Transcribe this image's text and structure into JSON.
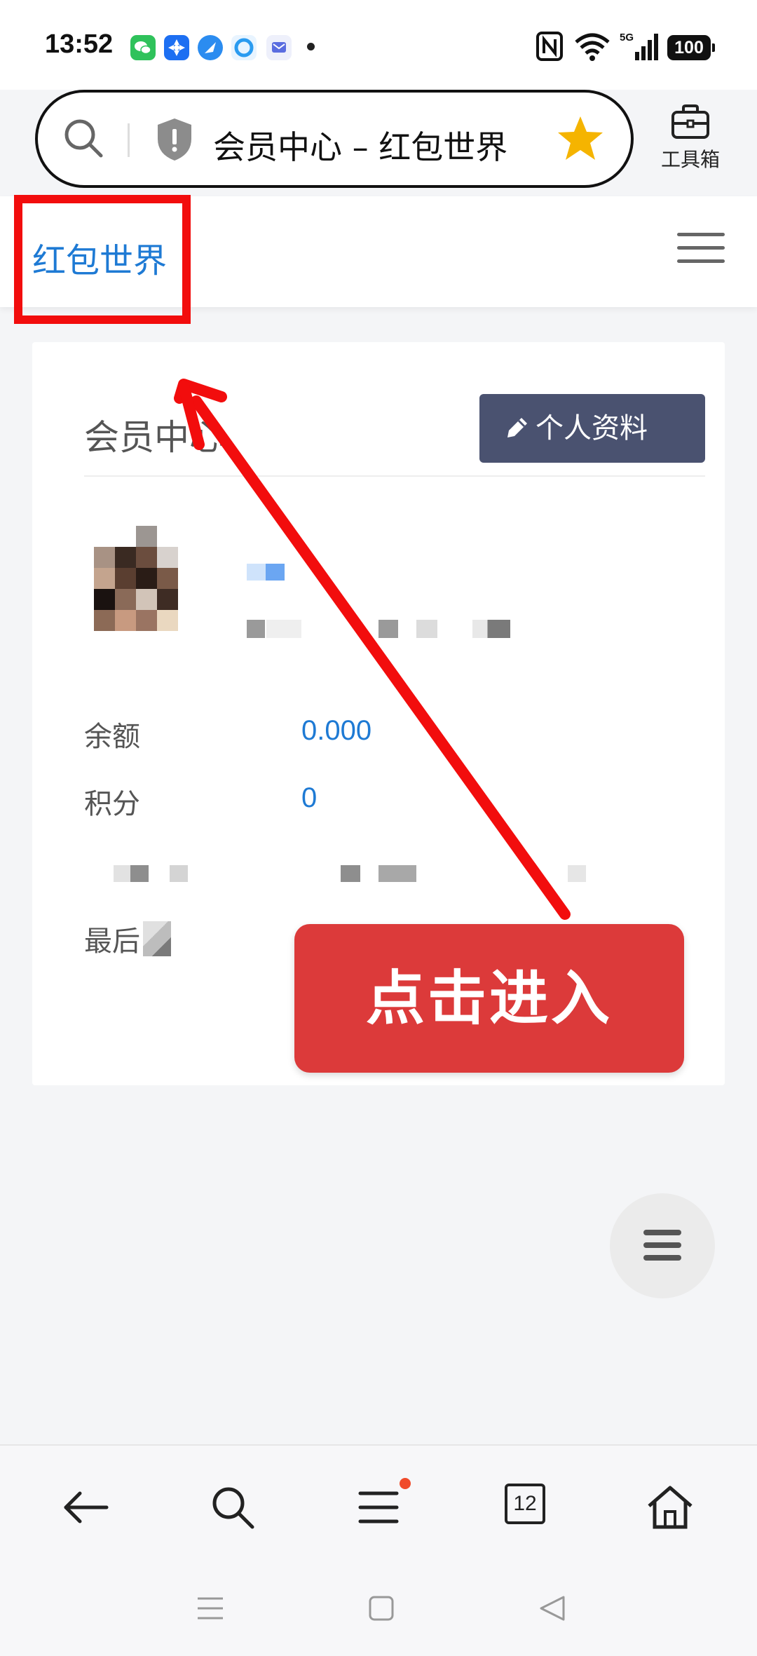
{
  "status_bar": {
    "time": "13:52",
    "battery": "100",
    "network": "5G",
    "apps": [
      "wechat-icon",
      "pinwheel-icon",
      "browser-icon",
      "qq-browser-icon",
      "message-icon"
    ],
    "indicators": [
      "nfc-icon",
      "wifi-icon",
      "signal-icon"
    ]
  },
  "address_bar": {
    "page_title": "会员中心 – 红包世界",
    "icons": [
      "search-icon",
      "shield-icon",
      "star-icon"
    ],
    "star_color": "#f5b400"
  },
  "toolbox": {
    "label": "工具箱",
    "icon": "toolbox-icon"
  },
  "site_header": {
    "brand": "红包世界",
    "brand_color": "#1e7ad4",
    "menu_icon": "hamburger-icon"
  },
  "member_card": {
    "title": "会员中心",
    "profile_button": "个人资料",
    "profile_button_color": "#4a5270",
    "fields": [
      {
        "label": "余额",
        "value": "0.000"
      },
      {
        "label": "积分",
        "value": "0"
      },
      {
        "label": "最后",
        "value": ""
      }
    ]
  },
  "annotation": {
    "cta_label": "点击进入",
    "cta_color": "#dc3a3a",
    "highlight_color": "#f20d0d"
  },
  "floating_menu": {
    "icon": "menu-icon"
  },
  "bottom_toolbar": {
    "items": [
      "back-icon",
      "search-icon",
      "list-icon",
      "tabs-icon",
      "home-icon"
    ],
    "tabs_count": "12"
  },
  "system_nav": {
    "items": [
      "recents-icon",
      "home-icon",
      "back-icon"
    ]
  }
}
